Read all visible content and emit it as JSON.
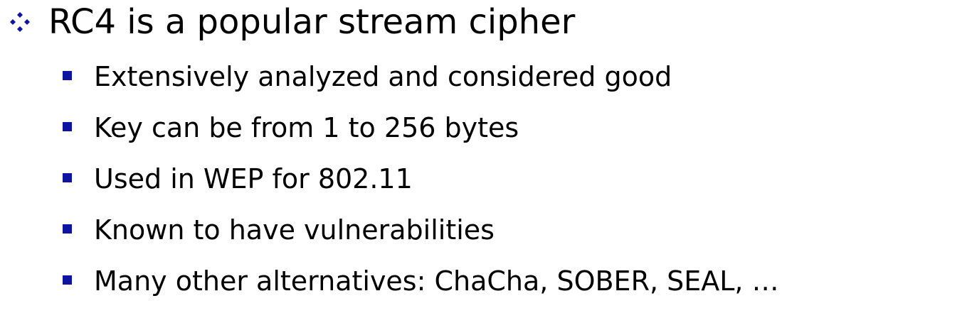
{
  "slide": {
    "main_bullet": {
      "text": "RC4 is a popular stream cipher",
      "icon": "diamond-bullet-icon"
    },
    "sub_bullets": [
      {
        "text": "Extensively analyzed and considered good",
        "icon": "square-bullet-icon"
      },
      {
        "text": "Key can be from 1 to 256 bytes",
        "icon": "square-bullet-icon"
      },
      {
        "text": "Used in WEP for 802.11",
        "icon": "square-bullet-icon"
      },
      {
        "text": "Known to have vulnerabilities",
        "icon": "square-bullet-icon"
      },
      {
        "text": "Many other alternatives: ChaCha, SOBER, SEAL, …",
        "icon": "square-bullet-icon"
      }
    ]
  },
  "colors": {
    "bullet": "#0c14a0",
    "text": "#000000",
    "background": "#ffffff"
  }
}
